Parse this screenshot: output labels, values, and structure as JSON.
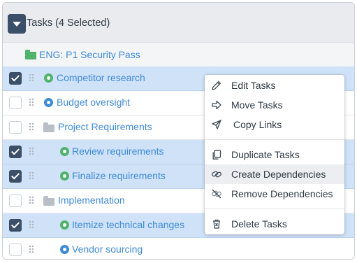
{
  "header": {
    "title": "Tasks (4 Selected)"
  },
  "group": {
    "label": "ENG: P1 Security Pass"
  },
  "rows": [
    {
      "label": "Competitor research",
      "selected": true,
      "kind": "task",
      "status": "green"
    },
    {
      "label": "Budget oversight",
      "selected": false,
      "kind": "task",
      "status": "blue"
    },
    {
      "label": "Project Requirements",
      "selected": false,
      "kind": "folder"
    },
    {
      "label": "Review requirements",
      "selected": true,
      "kind": "task",
      "status": "green"
    },
    {
      "label": "Finalize requirements",
      "selected": true,
      "kind": "task",
      "status": "green"
    },
    {
      "label": "Implementation",
      "selected": false,
      "kind": "folder"
    },
    {
      "label": "Itemize technical changes",
      "selected": true,
      "kind": "task",
      "status": "green"
    },
    {
      "label": "Vendor sourcing",
      "selected": false,
      "kind": "task",
      "status": "blue"
    }
  ],
  "menu": {
    "items": [
      {
        "label": "Edit Tasks",
        "icon": "pencil-icon"
      },
      {
        "label": "Move Tasks",
        "icon": "arrow-right-icon"
      },
      {
        "label": "Copy Links",
        "icon": "send-icon"
      },
      {
        "label": "Duplicate Tasks",
        "icon": "duplicate-icon"
      },
      {
        "label": "Create Dependencies",
        "icon": "link-icon"
      },
      {
        "label": "Remove Dependencies",
        "icon": "unlink-icon"
      },
      {
        "label": "Delete Tasks",
        "icon": "trash-icon"
      }
    ],
    "hovered": "Create Dependencies"
  },
  "colors": {
    "accent": "#3b4f68",
    "link": "#3f8bd6",
    "status_green": "#4fb36b",
    "selected_row": "#cfe2f8",
    "header_bg": "#e9ebee"
  }
}
